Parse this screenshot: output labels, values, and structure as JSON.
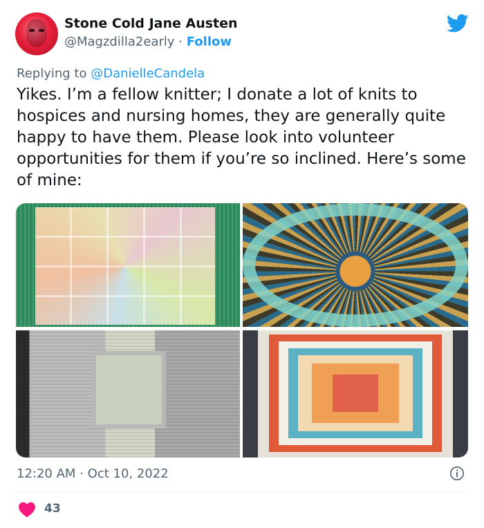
{
  "author": {
    "display_name": "Stone Cold Jane Austen",
    "handle": "@Magzdilla2early",
    "separator": "·",
    "follow_label": "Follow"
  },
  "reply": {
    "prefix": "Replying to",
    "mention": "@DanielleCandela"
  },
  "tweet": {
    "text": "Yikes. I’m a fellow knitter; I donate a lot of knits to hospices and nursing homes, they are generally quite happy to have them. Please look into volunteer opportunities for them if you’re so inclined. Here’s some of mine:"
  },
  "footer": {
    "time": "12:20 AM",
    "separator": "·",
    "date": "Oct 10, 2022",
    "likes": "43"
  },
  "colors": {
    "accent": "#1d9bf0",
    "like": "#f91880",
    "secondary_text": "#536471"
  },
  "icons": {
    "brand": "twitter-bird-icon",
    "info": "info-icon",
    "like": "heart-icon"
  }
}
